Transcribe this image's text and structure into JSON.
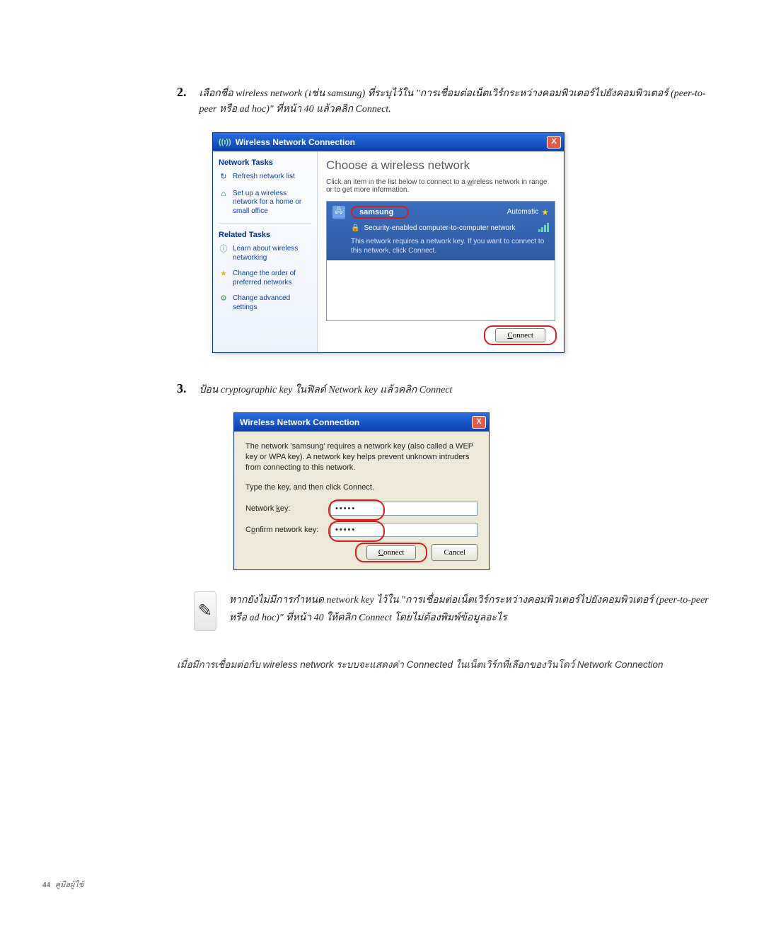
{
  "steps": {
    "s2_num": "2.",
    "s2_text": "เลือกชื่อ wireless network (เช่น samsung) ที่ระบุไว้ใน \"การเชื่อมต่อเน็ตเวิร์กระหว่างคอมพิวเตอร์ไปยังคอมพิวเตอร์ (peer-to-peer หรือ ad hoc)\" ที่หน้า 40 แล้วคลิก Connect.",
    "s3_num": "3.",
    "s3_text": "ป้อน cryptographic key ในฟิลด์ Network key แล้วคลิก Connect"
  },
  "dialog1": {
    "title": "Wireless Network Connection",
    "close": "X",
    "side": {
      "head1": "Network Tasks",
      "refresh": "Refresh network list",
      "setup": "Set up a wireless network for a home or small office",
      "head2": "Related Tasks",
      "learn": "Learn about wireless networking",
      "order": "Change the order of preferred networks",
      "adv": "Change advanced settings"
    },
    "main": {
      "title": "Choose a wireless network",
      "sub": "Click an item in the list below to connect to a wireless network in range or to get more information.",
      "ssid": "samsung",
      "auto": "Automatic",
      "sec": "Security-enabled computer-to-computer network",
      "req": "This network requires a network key. If you want to connect to this network, click Connect.",
      "connect": "Connect"
    }
  },
  "dialog2": {
    "title": "Wireless Network Connection",
    "close": "X",
    "desc": "The network 'samsung' requires a network key (also called a WEP key or WPA key). A network key helps prevent unknown intruders from connecting to this network.",
    "type": "Type the key, and then click Connect.",
    "lbl_key": "Network key:",
    "lbl_conf": "Confirm network key:",
    "val_key": "•••••",
    "val_conf": "•••••",
    "btn_connect": "Connect",
    "btn_cancel": "Cancel"
  },
  "note": {
    "text": "หากยังไม่มีการกำหนด network key ไว้ใน \"การเชื่อมต่อเน็ตเวิร์กระหว่างคอมพิวเตอร์ไปยังคอมพิวเตอร์ (peer-to-peer หรือ ad hoc)\" ที่หน้า 40 ให้คลิก Connect โดยไม่ต้องพิมพ์ข้อมูลอะไร"
  },
  "closing": "เมื่อมีการเชื่อมต่อกับ wireless network ระบบจะแสดงค่า Connected ในเน็ตเวิร์กที่เลือกของวินโดว์ Network Connection",
  "footer": {
    "page": "44",
    "label": "คู่มือผู้ใช้"
  }
}
